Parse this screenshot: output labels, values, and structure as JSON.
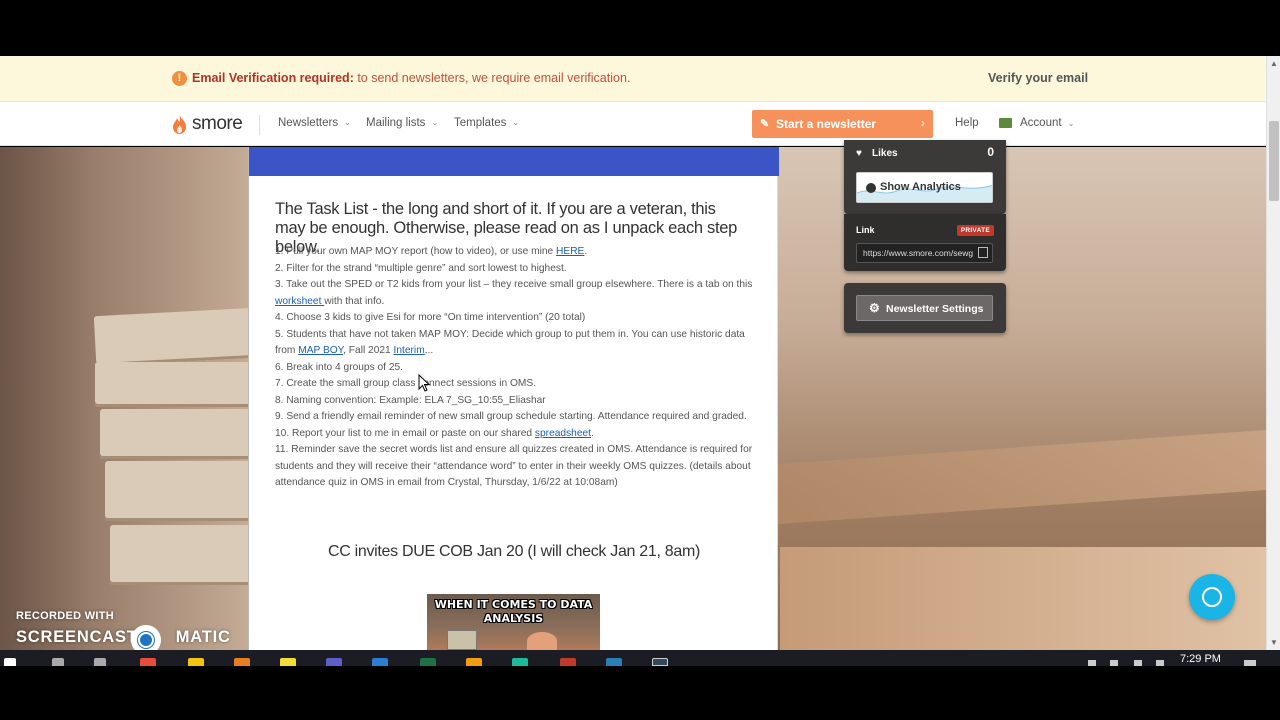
{
  "banner": {
    "title": "Email Verification required:",
    "message": " to send newsletters, we require email verification.",
    "action": "Verify your email"
  },
  "nav": {
    "logo": "smore",
    "menu": [
      "Newsletters",
      "Mailing lists",
      "Templates"
    ],
    "start_button": "Start a newsletter",
    "help": "Help",
    "account": "Account"
  },
  "newsletter": {
    "heading": "The Task List - the long and short of it. If you are a veteran, this may be enough. Otherwise, please read on as I unpack each step below.",
    "items": [
      {
        "pre": "1. Pull your own MAP MOY report (how to video), or use mine ",
        "link": "HERE",
        "post": "."
      },
      {
        "pre": "2. Filter for the strand “multiple genre” and sort lowest to highest.",
        "link": "",
        "post": ""
      },
      {
        "pre": "3. Take out the SPED or T2 kids from your list – they receive small group elsewhere. There is a tab on this ",
        "link": "worksheet ",
        "post": "with that info."
      },
      {
        "pre": "4. Choose 3 kids to give Esi for more “On time intervention” (20 total)",
        "link": "",
        "post": ""
      },
      {
        "pre": "5. Students that have not taken MAP MOY: Decide which group to put them in. You can use historic data from ",
        "link": "MAP BOY",
        "post": ", Fall 2021 ",
        "link2": "Interim",
        "post2": "..."
      },
      {
        "pre": "6. Break into 4 groups of 25.",
        "link": "",
        "post": ""
      },
      {
        "pre": "7. Create the small group class connect sessions in OMS.",
        "link": "",
        "post": ""
      },
      {
        "pre": "8. Naming convention: Example: ELA 7_SG_10:55_Eliashar",
        "link": "",
        "post": ""
      },
      {
        "pre": "9. Send a friendly email reminder of new small group schedule starting. Attendance required and graded.",
        "link": "",
        "post": ""
      },
      {
        "pre": "10. Report your list to me in email or paste on our shared ",
        "link": "spreadsheet",
        "post": "."
      },
      {
        "pre": "11. Reminder save the secret words list and ensure all quizzes created in OMS. Attendance is required for students and they will receive their “attendance word” to enter in their weekly OMS quizzes. (details about attendance quiz in OMS in email from Crystal, Thursday, 1/6/22 at 10:08am)",
        "link": "",
        "post": ""
      }
    ],
    "deadline": "CC invites DUE COB Jan 20 (I will check Jan 21, 8am)",
    "meme_text": "WHEN IT COMES TO DATA ANALYSIS"
  },
  "sidebar": {
    "likes_label": "Likes",
    "likes_count": "0",
    "analytics_button": "Show Analytics",
    "link_label": "Link",
    "privacy_badge": "PRIVATE",
    "link_url": "https://www.smore.com/sewg",
    "settings_button": "Newsletter Settings"
  },
  "watermark": {
    "line1": "RECORDED WITH",
    "line2a": "SCREENCAST",
    "line2b": "MATIC"
  },
  "taskbar": {
    "time": "7:29 PM"
  },
  "colors": {
    "accent_orange": "#f7915c",
    "newsletter_blue": "#3c55c6",
    "chat_blue": "#1ab5e6",
    "private_red": "#c0392b"
  },
  "icons": [
    "warning-icon",
    "flame-logo-icon",
    "pencil-icon",
    "account-icon",
    "heart-icon",
    "pie-chart-icon",
    "copy-icon",
    "gear-icon",
    "chat-icon"
  ]
}
